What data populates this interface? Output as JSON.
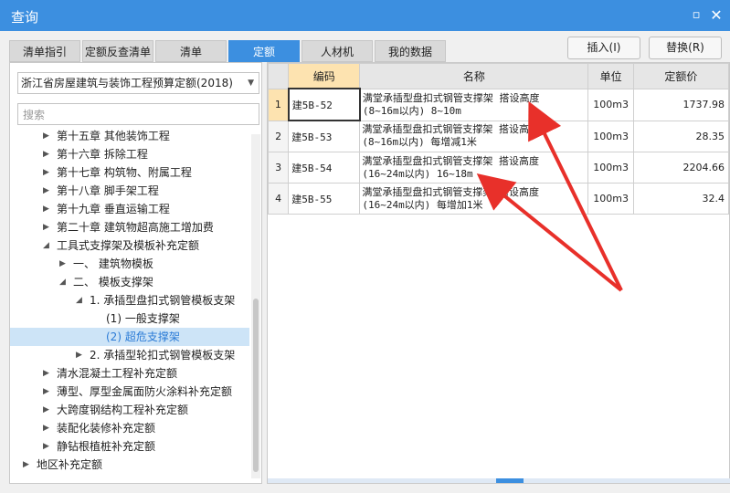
{
  "window": {
    "title": "查询",
    "min_icon": "minimize-icon",
    "close_icon": "close-icon"
  },
  "tabs": [
    {
      "label": "清单指引",
      "active": false
    },
    {
      "label": "定额反查清单",
      "active": false
    },
    {
      "label": "清单",
      "active": false
    },
    {
      "label": "定额",
      "active": true
    },
    {
      "label": "人材机",
      "active": false
    },
    {
      "label": "我的数据",
      "active": false
    }
  ],
  "actions": {
    "insert": "插入(I)",
    "replace": "替换(R)"
  },
  "left": {
    "library": "浙江省房屋建筑与装饰工程预算定额(2018)",
    "search_placeholder": "搜索",
    "tree": [
      {
        "label": "第十五章 其他装饰工程",
        "expander": "collapsed"
      },
      {
        "label": "第十六章 拆除工程",
        "expander": "collapsed"
      },
      {
        "label": "第十七章 构筑物、附属工程",
        "expander": "collapsed"
      },
      {
        "label": "第十八章 脚手架工程",
        "expander": "collapsed"
      },
      {
        "label": "第十九章 垂直运输工程",
        "expander": "collapsed"
      },
      {
        "label": "第二十章 建筑物超高施工增加费",
        "expander": "collapsed"
      },
      {
        "label": "工具式支撑架及模板补充定额",
        "expander": "expanded"
      },
      {
        "label": "一、 建筑物模板",
        "expander": "collapsed"
      },
      {
        "label": "二、 模板支撑架",
        "expander": "expanded"
      },
      {
        "label": "1. 承插型盘扣式钢管模板支架",
        "expander": "expanded"
      },
      {
        "label": "(1) 一般支撑架",
        "expander": "none"
      },
      {
        "label": "(2) 超危支撑架",
        "expander": "none",
        "selected": true
      },
      {
        "label": "2. 承插型轮扣式钢管模板支架",
        "expander": "collapsed"
      },
      {
        "label": "清水混凝土工程补充定额",
        "expander": "collapsed"
      },
      {
        "label": "薄型、厚型金属面防火涂料补充定额",
        "expander": "collapsed"
      },
      {
        "label": "大跨度钢结构工程补充定额",
        "expander": "collapsed"
      },
      {
        "label": "装配化装修补充定额",
        "expander": "collapsed"
      },
      {
        "label": "静钻根植桩补充定额",
        "expander": "collapsed"
      },
      {
        "label": "地区补充定额",
        "expander": "collapsed"
      }
    ]
  },
  "grid": {
    "headers": {
      "code": "编码",
      "name": "名称",
      "unit": "单位",
      "price": "定额价"
    },
    "rows": [
      {
        "no": "1",
        "code": "建5B-52",
        "name1": "满堂承插型盘扣式钢管支撑架 搭设高度",
        "name2": "(8~16m以内) 8~10m",
        "unit": "100m3",
        "price": "1737.98"
      },
      {
        "no": "2",
        "code": "建5B-53",
        "name1": "满堂承插型盘扣式钢管支撑架 搭设高度",
        "name2": "(8~16m以内) 每增减1米",
        "unit": "100m3",
        "price": "28.35"
      },
      {
        "no": "3",
        "code": "建5B-54",
        "name1": "满堂承插型盘扣式钢管支撑架 搭设高度",
        "name2": "(16~24m以内) 16~18m",
        "unit": "100m3",
        "price": "2204.66"
      },
      {
        "no": "4",
        "code": "建5B-55",
        "name1": "满堂承插型盘扣式钢管支撑架 搭设高度",
        "name2": "(16~24m以内) 每增加1米",
        "unit": "100m3",
        "price": "32.4"
      }
    ]
  },
  "colors": {
    "accent": "#3c8fe0",
    "annotation": "#e8302a",
    "highlight": "#fde3b0",
    "selected_row": "#cde4f7"
  }
}
